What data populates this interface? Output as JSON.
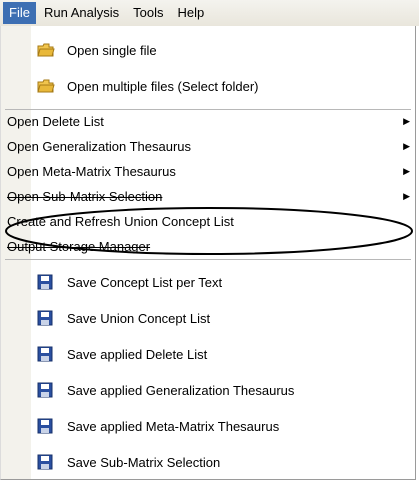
{
  "menubar": {
    "items": [
      {
        "label": "File"
      },
      {
        "label": "Run Analysis"
      },
      {
        "label": "Tools"
      },
      {
        "label": "Help"
      }
    ]
  },
  "file_menu": {
    "open_items": [
      {
        "label": "Open single file",
        "icon": "folder-icon"
      },
      {
        "label": "Open multiple files (Select folder)",
        "icon": "folder-icon"
      }
    ],
    "submenu_items": [
      {
        "label": "Open Delete List"
      },
      {
        "label": "Open Generalization Thesaurus"
      },
      {
        "label": "Open Meta-Matrix Thesaurus"
      },
      {
        "label": "Open Sub-Matrix Selection"
      }
    ],
    "create_refresh_label": "Create and Refresh Union Concept List",
    "output_storage_label": "Output Storage Manager",
    "save_items": [
      {
        "label": "Save Concept List per Text",
        "icon": "floppy-disk-icon"
      },
      {
        "label": "Save Union Concept List",
        "icon": "floppy-disk-icon"
      },
      {
        "label": "Save applied Delete List",
        "icon": "floppy-disk-icon"
      },
      {
        "label": "Save applied Generalization Thesaurus",
        "icon": "floppy-disk-icon"
      },
      {
        "label": "Save applied Meta-Matrix Thesaurus",
        "icon": "floppy-disk-icon"
      },
      {
        "label": "Save Sub-Matrix Selection",
        "icon": "floppy-disk-icon"
      }
    ]
  },
  "colors": {
    "active_menu": "#3d6fb3",
    "icon_strip": "#f3f2ec",
    "floppy": "#2a4fa0",
    "folder": "#e8b83a"
  }
}
